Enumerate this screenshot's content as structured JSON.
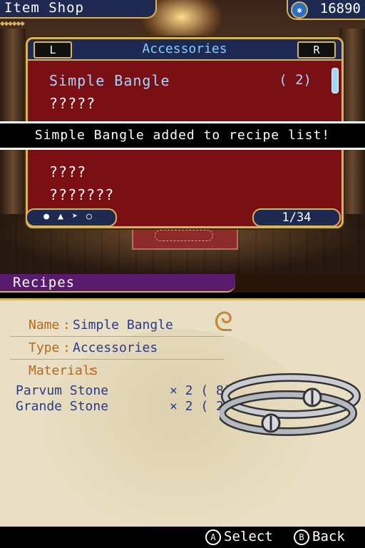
{
  "header": {
    "shop_title": "Item Shop",
    "money": "16890",
    "coin_icon": "currency-icon"
  },
  "list": {
    "left_button": "L",
    "right_button": "R",
    "category": "Accessories",
    "items": [
      "Simple Bangle",
      "?????",
      "------",
      "????",
      "???????"
    ],
    "selected_quantity": "( 2)",
    "page": "1/34",
    "filter_icons": [
      "pot-icon",
      "flask-icon",
      "cursor-icon",
      "ring-icon"
    ]
  },
  "notice": "Simple Bangle added to recipe list!",
  "recipes": {
    "title": "Recipes",
    "name_label": "Name",
    "name_value": "Simple Bangle",
    "type_label": "Type",
    "type_value": "Accessories",
    "materials_label": "Materials",
    "materials": [
      {
        "name": "Parvum Stone",
        "qty": "× 2 ( 8)"
      },
      {
        "name": "Grande Stone",
        "qty": "× 2 ( 2)"
      }
    ]
  },
  "controls": {
    "select_button": "A",
    "select_label": "Select",
    "back_button": "B",
    "back_label": "Back"
  },
  "colors": {
    "accent_gold": "#d7b45a",
    "list_bg": "#7a0f14",
    "header_blue": "#1f2a52",
    "recipes_purple": "#5a1a6e"
  }
}
